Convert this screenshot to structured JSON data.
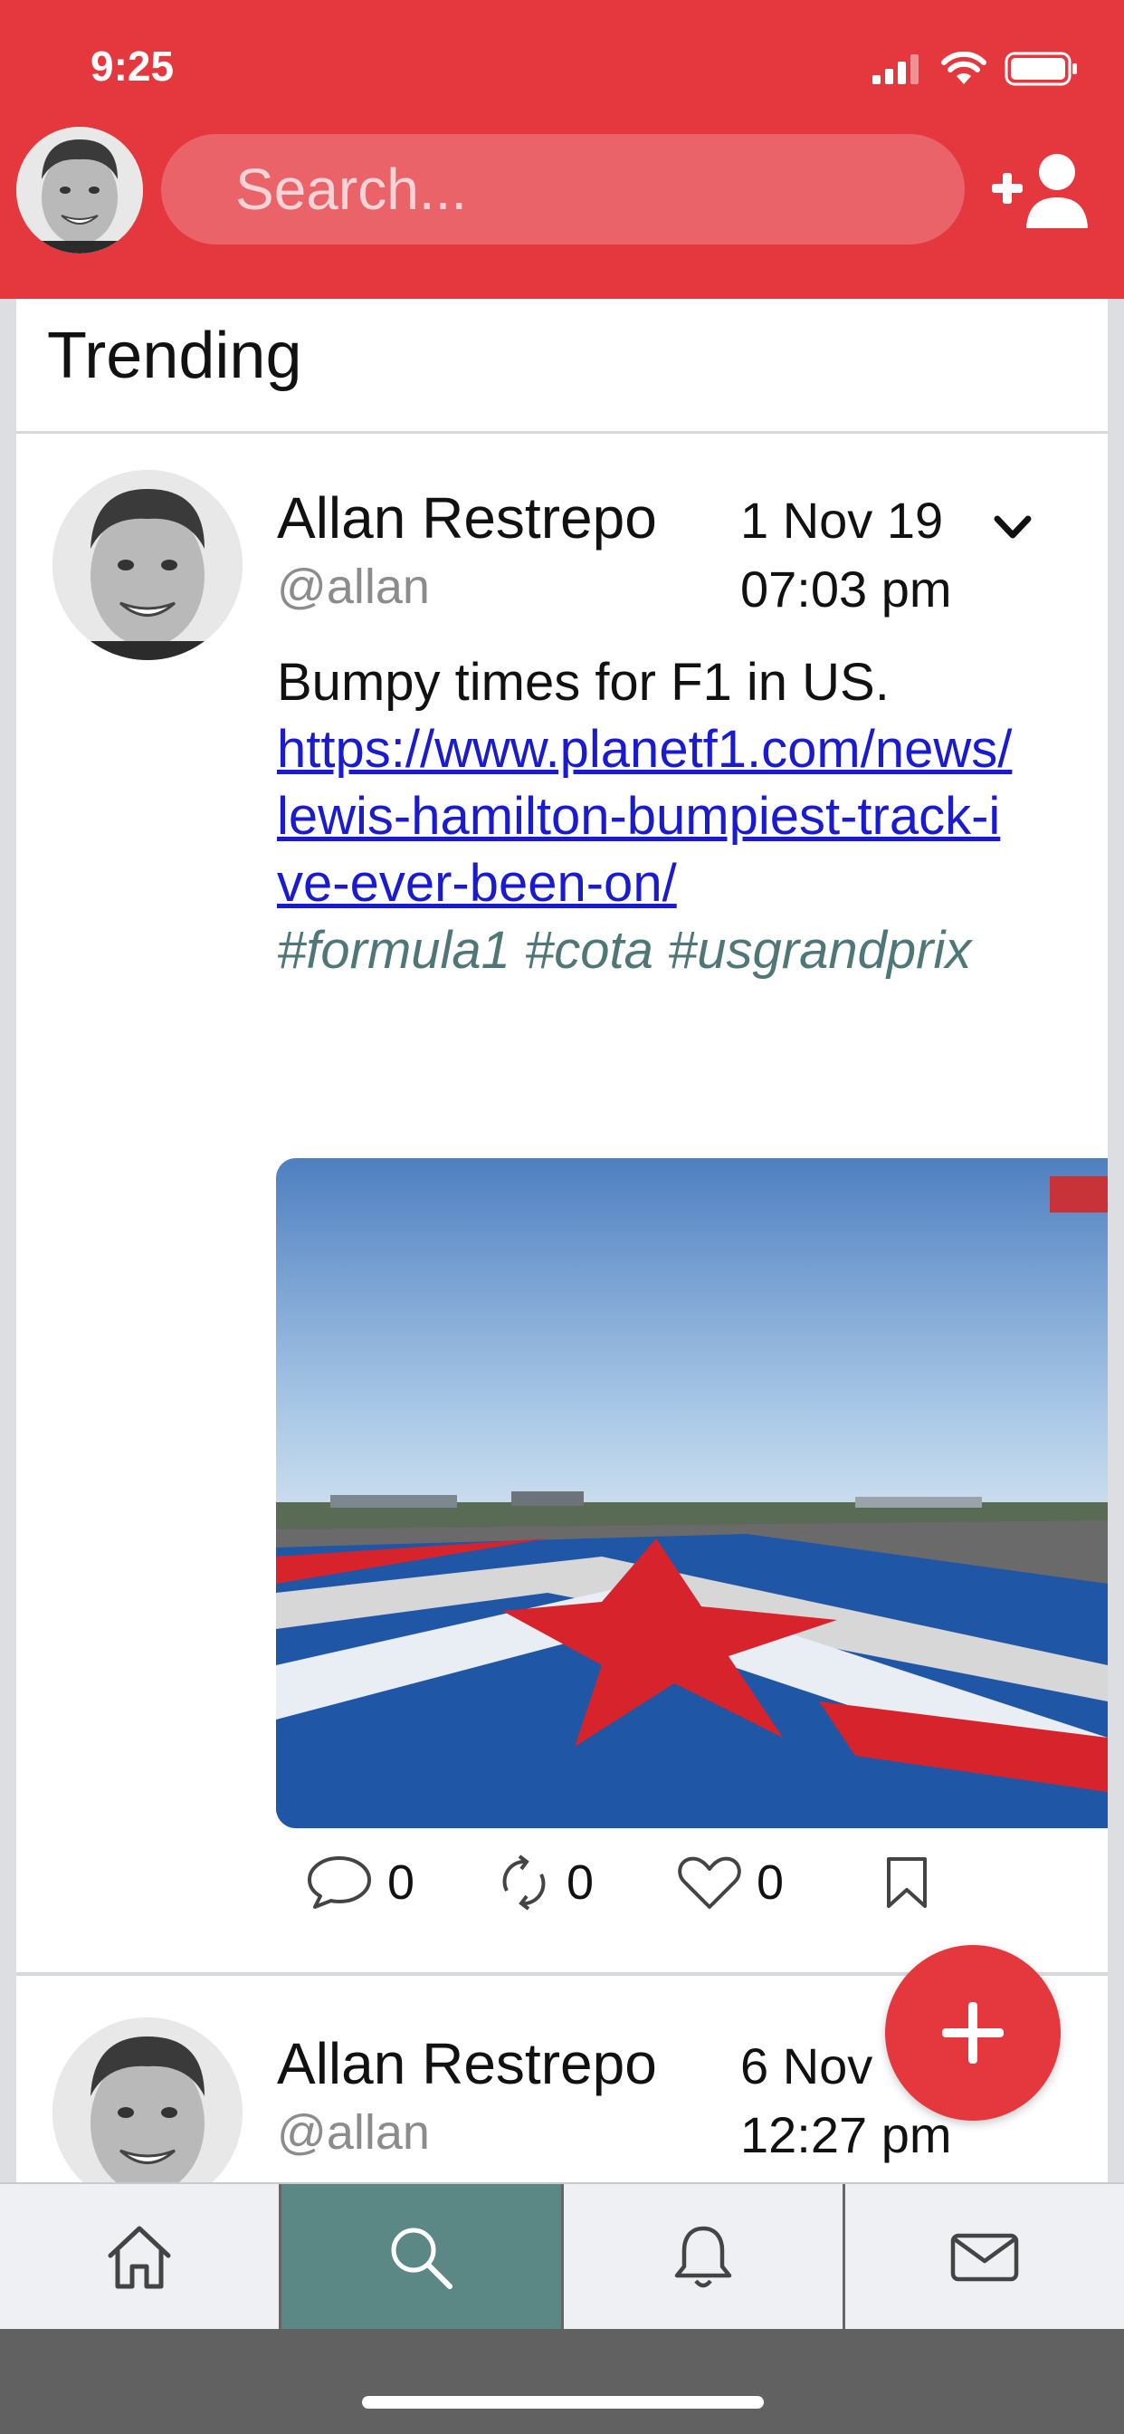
{
  "status_bar": {
    "time": "9:25"
  },
  "header": {
    "search_placeholder": "Search..."
  },
  "feed": {
    "section_title": "Trending",
    "posts": [
      {
        "author": "Allan Restrepo",
        "handle": "@allan",
        "date": "1 Nov 19",
        "time": "07:03 pm",
        "text": "Bumpy times for F1 in US.",
        "link": "https://www.planetf1.com/news/lewis-hamilton-bumpiest-track-ive-ever-been-on/",
        "hashtags": "#formula1 #cota #usgrandprix",
        "replies": "0",
        "reposts": "0",
        "likes": "0"
      },
      {
        "author": "Allan Restrepo",
        "handle": "@allan",
        "date": "6 Nov",
        "time": "12:27 pm"
      }
    ]
  },
  "icons": {
    "header": [
      "avatar",
      "search-icon",
      "add-user-icon"
    ],
    "post_actions": [
      "comment-icon",
      "repost-icon",
      "heart-icon",
      "bookmark-icon"
    ],
    "fab": "plus-icon",
    "nav": [
      "home-icon",
      "search-icon",
      "bell-icon",
      "mail-icon"
    ]
  },
  "colors": {
    "accent": "#e5383e",
    "nav_active": "#5b8784",
    "link": "#1a1ad0",
    "hashtag": "#507777"
  }
}
